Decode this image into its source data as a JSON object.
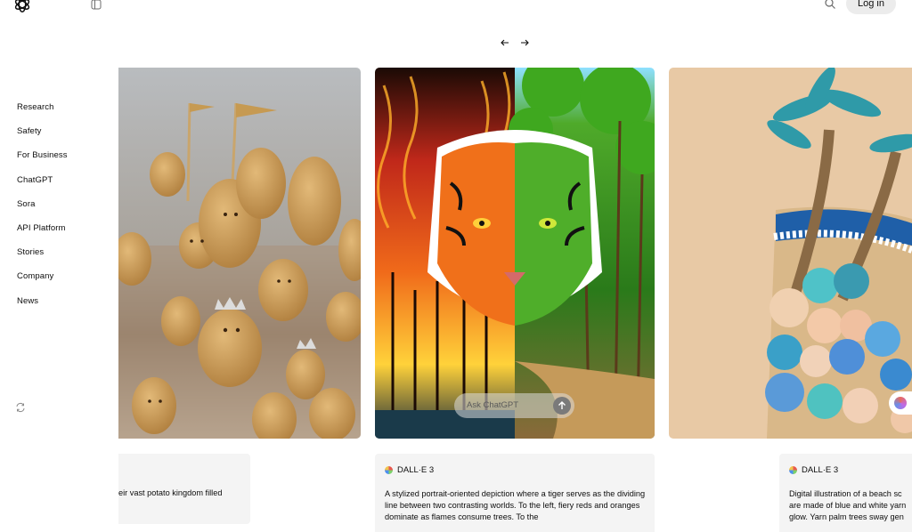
{
  "header": {
    "logo_icon": "openai-logo-icon",
    "sidebar_toggle_icon": "sidebar-toggle-icon",
    "search_icon": "search-icon",
    "login_label": "Log in"
  },
  "carousel": {
    "prev_icon": "arrow-left-icon",
    "next_icon": "arrow-right-icon"
  },
  "sidebar": {
    "items": [
      {
        "label": "Research"
      },
      {
        "label": "Safety"
      },
      {
        "label": "For Business"
      },
      {
        "label": "ChatGPT"
      },
      {
        "label": "Sora"
      },
      {
        "label": "API Platform"
      },
      {
        "label": "Stories"
      },
      {
        "label": "Company"
      },
      {
        "label": "News"
      }
    ],
    "theme_icon": "theme-toggle-icon"
  },
  "overlay": {
    "ask_placeholder": "Ask ChatGPT",
    "send_icon": "arrow-up-icon",
    "badge_icon": "ai-badge-icon"
  },
  "cards": [
    {
      "image": "potato kingdom image",
      "model": "",
      "caption": "eir vast potato kingdom filled"
    },
    {
      "image": "tiger fire and forest image",
      "model": "DALL·E 3",
      "caption": "A stylized portrait-oriented depiction where a tiger serves as the dividing line between two contrasting worlds. To the left, fiery reds and oranges dominate as flames consume trees. To the"
    },
    {
      "image": "yarn beach image",
      "model": "DALL·E 3",
      "caption_lines": [
        "Digital illustration of a beach sc",
        "are made of blue and white yarn",
        "glow. Yarn palm trees sway gen"
      ]
    }
  ]
}
